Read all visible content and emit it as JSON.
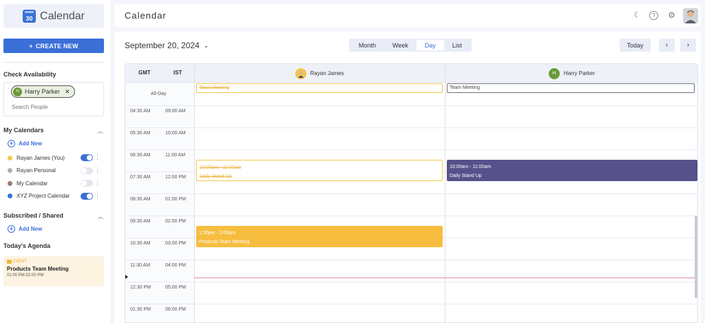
{
  "sidebar": {
    "logo_text": "Calendar",
    "logo_day": "30",
    "create_label": "CREATE NEW",
    "check_availability": "Check Availability",
    "chip_name": "Harry Parker",
    "chip_initial": "H",
    "search_placeholder": "Search People",
    "my_calendars": "My Calendars",
    "add_new": "Add New",
    "calendars": [
      {
        "label": "Rayan James (You)",
        "color": "#f3c74b",
        "enabled": true
      },
      {
        "label": "Rayan Personal",
        "color": "#aab0bb",
        "enabled": false
      },
      {
        "label": "My Calendar",
        "color": "#9c7a6a",
        "enabled": false
      },
      {
        "label": "XYZ Project Calendar",
        "color": "#3b6fd8",
        "enabled": true
      }
    ],
    "subscribed": "Subscribed / Shared",
    "todays_agenda": "Today's Agenda",
    "agenda": {
      "type": "EVENT",
      "title": "Products Team Meeting",
      "time": "01:00 PM-02:00 PM"
    }
  },
  "header": {
    "title": "Calendar"
  },
  "toolbar": {
    "date": "September 20, 2024",
    "views": [
      "Month",
      "Week",
      "Day",
      "List"
    ],
    "active_view": "Day",
    "today": "Today"
  },
  "grid": {
    "tz1": "GMT",
    "tz2": "IST",
    "allday": "All-Day",
    "people": [
      {
        "name": "Rayan James",
        "initial": ""
      },
      {
        "name": "Harry Parker",
        "initial": "H"
      }
    ],
    "times": [
      [
        "04:30 AM",
        "09:00 AM"
      ],
      [
        "05:30 AM",
        "10:00 AM"
      ],
      [
        "06:30 AM",
        "11:00 AM"
      ],
      [
        "07:30 AM",
        "12:00 PM"
      ],
      [
        "08:30 AM",
        "01:00 PM"
      ],
      [
        "09:30 AM",
        "02:00 PM"
      ],
      [
        "10:30 AM",
        "03:00 PM"
      ],
      [
        "11:30 AM",
        "04:00 PM"
      ],
      [
        "12:30 PM",
        "05:00 PM"
      ],
      [
        "01:30 PM",
        "06:00 PM"
      ]
    ],
    "allday_events": {
      "rayan": "Team Meeting",
      "harry": "Team Meeting"
    },
    "events": {
      "standup_rayan": {
        "time": "10:00am - 11:00am",
        "title": "Daily Stand Up"
      },
      "standup_harry": {
        "time": "10:00am - 11:00am",
        "title": "Daily Stand Up"
      },
      "products": {
        "time": "1:00pm - 2:00pm",
        "title": "Products Team Meeting"
      }
    }
  }
}
